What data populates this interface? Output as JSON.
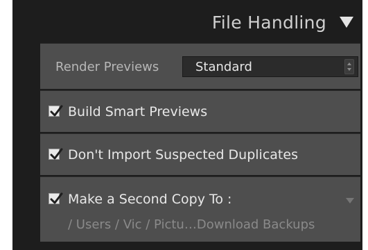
{
  "header": {
    "title": "File Handling",
    "toggle_icon": "triangle-down-icon"
  },
  "render_previews": {
    "label": "Render Previews",
    "selected": "Standard",
    "stepper_icon": "up-down-arrows-icon"
  },
  "options": {
    "smart_previews": {
      "label": "Build Smart Previews",
      "checked": true
    },
    "no_duplicates": {
      "label": "Don't Import Suspected Duplicates",
      "checked": true
    },
    "second_copy": {
      "label": "Make a Second Copy To :",
      "checked": true,
      "path": "/ Users / Vic / Pictu…Download Backups",
      "dropdown_icon": "triangle-down-icon"
    }
  },
  "colors": {
    "panel_bg": "#1d1d1d",
    "section_bg": "#4e4e4e",
    "select_bg": "#2b2b2b",
    "text": "#e8e8e8"
  }
}
